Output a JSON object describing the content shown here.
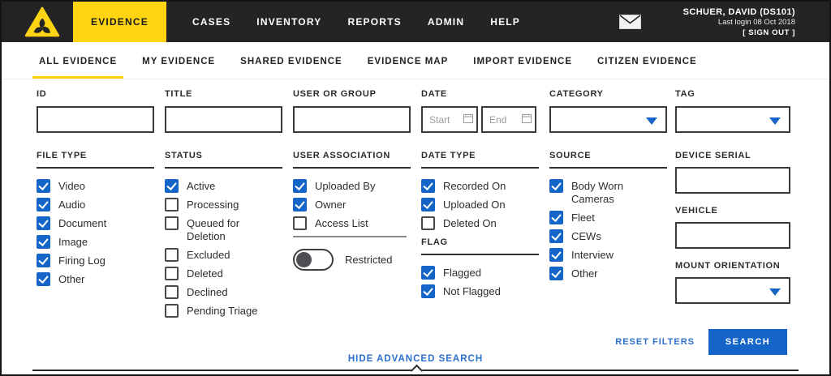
{
  "nav": {
    "items": [
      {
        "label": "EVIDENCE",
        "active": true
      },
      {
        "label": "CASES",
        "active": false
      },
      {
        "label": "INVENTORY",
        "active": false
      },
      {
        "label": "REPORTS",
        "active": false
      },
      {
        "label": "ADMIN",
        "active": false
      },
      {
        "label": "HELP",
        "active": false
      }
    ],
    "mail_icon": "envelope-icon",
    "user_name": "SCHUER, DAVID (DS101)",
    "last_login": "Last login 08 Oct 2018",
    "sign_out": "[ SIGN OUT ]"
  },
  "tabs": [
    {
      "label": "ALL EVIDENCE",
      "active": true
    },
    {
      "label": "MY EVIDENCE",
      "active": false
    },
    {
      "label": "SHARED EVIDENCE",
      "active": false
    },
    {
      "label": "EVIDENCE MAP",
      "active": false
    },
    {
      "label": "IMPORT EVIDENCE",
      "active": false
    },
    {
      "label": "CITIZEN EVIDENCE",
      "active": false
    }
  ],
  "filters": {
    "id": {
      "label": "ID",
      "value": ""
    },
    "title": {
      "label": "TITLE",
      "value": ""
    },
    "user_or_group": {
      "label": "USER OR GROUP",
      "value": ""
    },
    "date": {
      "label": "DATE",
      "start_placeholder": "Start",
      "end_placeholder": "End"
    },
    "category": {
      "label": "CATEGORY",
      "value": ""
    },
    "tag": {
      "label": "TAG",
      "value": ""
    },
    "file_type": {
      "label": "FILE TYPE",
      "options": [
        {
          "label": "Video",
          "checked": true
        },
        {
          "label": "Audio",
          "checked": true
        },
        {
          "label": "Document",
          "checked": true
        },
        {
          "label": "Image",
          "checked": true
        },
        {
          "label": "Firing Log",
          "checked": true
        },
        {
          "label": "Other",
          "checked": true
        }
      ]
    },
    "status": {
      "label": "STATUS",
      "options": [
        {
          "label": "Active",
          "checked": true
        },
        {
          "label": "Processing",
          "checked": false
        },
        {
          "label": "Queued for Deletion",
          "checked": false
        },
        {
          "label": "Excluded",
          "checked": false
        },
        {
          "label": "Deleted",
          "checked": false
        },
        {
          "label": "Declined",
          "checked": false
        },
        {
          "label": "Pending Triage",
          "checked": false
        }
      ]
    },
    "user_association": {
      "label": "USER ASSOCIATION",
      "options": [
        {
          "label": "Uploaded By",
          "checked": true
        },
        {
          "label": "Owner",
          "checked": true
        },
        {
          "label": "Access List",
          "checked": false
        }
      ],
      "restricted": {
        "label": "Restricted",
        "on": false
      }
    },
    "date_type": {
      "label": "DATE TYPE",
      "options": [
        {
          "label": "Recorded On",
          "checked": true
        },
        {
          "label": "Uploaded On",
          "checked": true
        },
        {
          "label": "Deleted On",
          "checked": false
        }
      ]
    },
    "flag": {
      "label": "FLAG",
      "options": [
        {
          "label": "Flagged",
          "checked": true
        },
        {
          "label": "Not Flagged",
          "checked": true
        }
      ]
    },
    "source": {
      "label": "SOURCE",
      "options": [
        {
          "label": "Body Worn Cameras",
          "checked": true
        },
        {
          "label": "Fleet",
          "checked": true
        },
        {
          "label": "CEWs",
          "checked": true
        },
        {
          "label": "Interview",
          "checked": true
        },
        {
          "label": "Other",
          "checked": true
        }
      ]
    },
    "device_serial": {
      "label": "DEVICE SERIAL",
      "value": ""
    },
    "vehicle": {
      "label": "VEHICLE",
      "value": ""
    },
    "mount_orientation": {
      "label": "MOUNT ORIENTATION",
      "value": ""
    }
  },
  "actions": {
    "reset_label": "RESET FILTERS",
    "search_label": "SEARCH"
  },
  "footer": {
    "toggle_label": "HIDE ADVANCED SEARCH"
  },
  "colors": {
    "accent_yellow": "#FFD513",
    "accent_blue": "#1565C8",
    "link_blue": "#2A6FD1",
    "nav_bg": "#242424"
  }
}
